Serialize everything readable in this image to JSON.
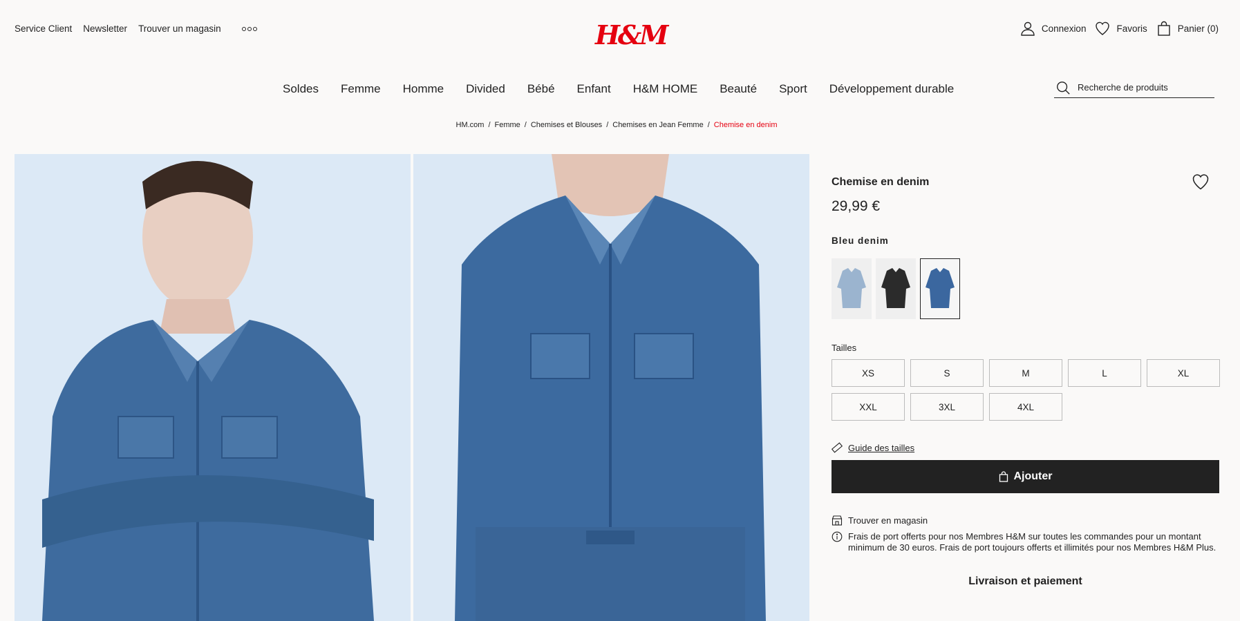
{
  "header": {
    "utility_links": [
      "Service Client",
      "Newsletter",
      "Trouver un magasin"
    ],
    "more_icon": "more-dots-icon",
    "logo_text": "H&M",
    "account": {
      "login": "Connexion",
      "favorites": "Favoris",
      "cart": "Panier (0)"
    }
  },
  "nav": {
    "items": [
      "Soldes",
      "Femme",
      "Homme",
      "Divided",
      "Bébé",
      "Enfant",
      "H&M HOME",
      "Beauté",
      "Sport",
      "Développement durable"
    ]
  },
  "search": {
    "placeholder": "Recherche de produits"
  },
  "breadcrumb": [
    "HM.com",
    "Femme",
    "Chemises et Blouses",
    "Chemises en Jean Femme",
    "Chemise en denim"
  ],
  "product": {
    "title": "Chemise en denim",
    "price": "29,99 €",
    "color_name": "Bleu denim",
    "swatches": [
      {
        "color": "#9bb4cf",
        "selected": false
      },
      {
        "color": "#2b2b2b",
        "selected": false
      },
      {
        "color": "#3b679f",
        "selected": true
      }
    ],
    "sizes_label": "Tailles",
    "sizes": [
      "XS",
      "S",
      "M",
      "L",
      "XL",
      "XXL",
      "3XL",
      "4XL"
    ],
    "size_guide": "Guide des tailles",
    "add_button": "Ajouter",
    "find_in_store": "Trouver en magasin",
    "shipping_info": "Frais de port offerts pour nos Membres H&M sur toutes les commandes pour un montant minimum de 30 euros. Frais de port toujours offerts et illimités pour nos Membres H&M Plus.",
    "delivery_link": "Livraison et paiement"
  },
  "colors": {
    "brand": "#e50010",
    "button": "#222222",
    "background": "#faf9f8"
  }
}
